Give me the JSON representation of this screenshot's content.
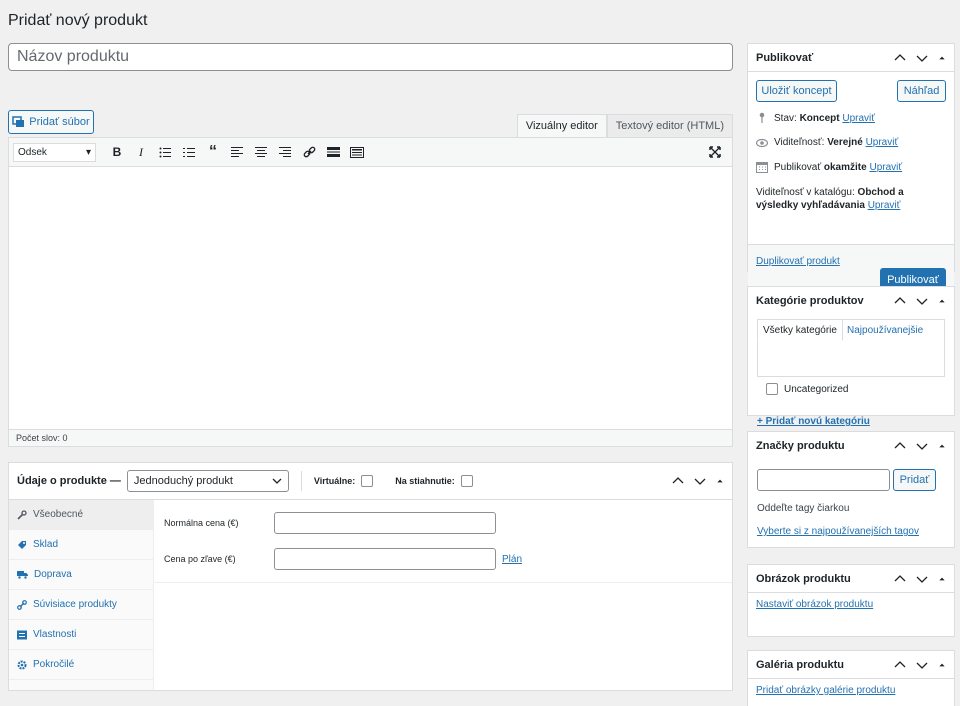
{
  "page": {
    "title": "Pridať nový produkt"
  },
  "title_field": {
    "placeholder": "Názov produktu"
  },
  "media": {
    "add_label": "Pridať súbor"
  },
  "editor": {
    "tab_visual": "Vizuálny editor",
    "tab_text": "Textový editor (HTML)",
    "format_value": "Odsek",
    "word_count": "Počet slov: 0"
  },
  "product_data": {
    "title": "Údaje o produkte —",
    "type_value": "Jednoduchý produkt",
    "virtual_label": "Virtuálne:",
    "download_label": "Na stiahnutie:",
    "tabs": [
      {
        "label": "Všeobecné",
        "icon": "wrench-icon"
      },
      {
        "label": "Sklad",
        "icon": "tag-icon"
      },
      {
        "label": "Doprava",
        "icon": "truck-icon"
      },
      {
        "label": "Súvisiace produkty",
        "icon": "link-icon"
      },
      {
        "label": "Vlastnosti",
        "icon": "list-icon"
      },
      {
        "label": "Pokročilé",
        "icon": "gear-icon"
      }
    ],
    "regular_price_label": "Normálna cena (€)",
    "sale_price_label": "Cena po zľave (€)",
    "schedule_link": "Plán"
  },
  "publish": {
    "title": "Publikovať",
    "save_draft": "Uložiť koncept",
    "preview": "Náhľad",
    "status_label": "Stav:",
    "status_value": "Koncept",
    "visibility_label": "Viditeľnosť:",
    "visibility_value": "Verejné",
    "publish_label": "Publikovať",
    "publish_value": "okamžite",
    "edit_link": "Upraviť",
    "catalog_label": "Viditeľnosť v katalógu:",
    "catalog_value": "Obchod a výsledky vyhľadávania",
    "duplicate_link": "Duplikovať produkt",
    "publish_button": "Publikovať"
  },
  "categories": {
    "title": "Kategórie produktov",
    "tab_all": "Všetky kategórie",
    "tab_popular": "Najpoužívanejšie",
    "item": "Uncategorized",
    "add_link": "+ Pridať novú kategóriu"
  },
  "tags": {
    "title": "Značky produktu",
    "add_button": "Pridať",
    "hint": "Oddeľte tagy čiarkou",
    "choose_link": "Vyberte si z najpoužívanejších tagov"
  },
  "image": {
    "title": "Obrázok produktu",
    "set_link": "Nastaviť obrázok produktu"
  },
  "gallery": {
    "title": "Galéria produktu",
    "add_link": "Pridať obrázky galérie produktu"
  }
}
